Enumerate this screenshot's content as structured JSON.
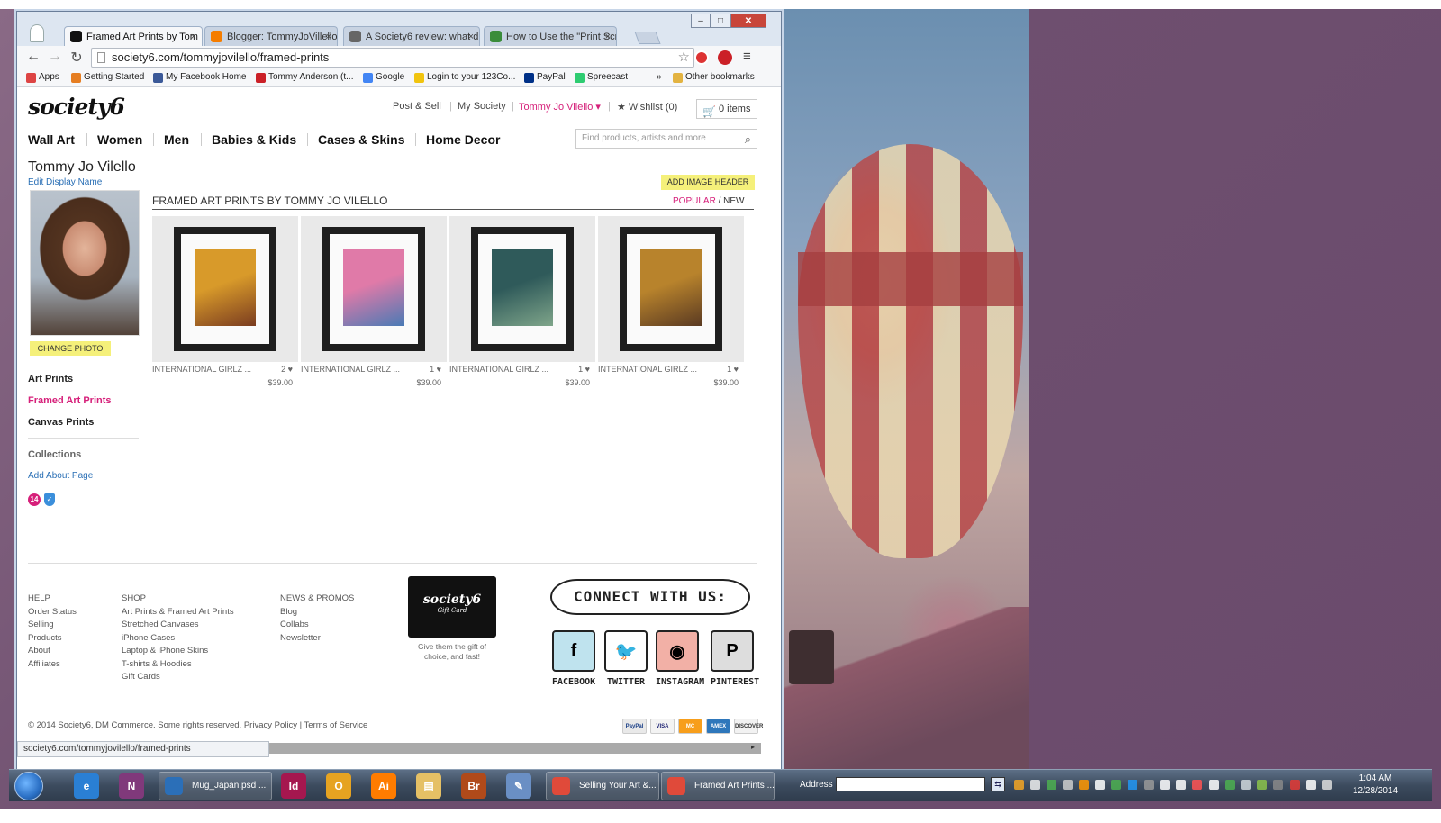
{
  "browser": {
    "tabs": [
      {
        "label": "Framed Art Prints by Tom",
        "active": true,
        "favicon_color": "#111111"
      },
      {
        "label": "Blogger: TommyJoVillello",
        "active": false,
        "favicon_color": "#f57d00"
      },
      {
        "label": "A Society6 review: what d",
        "active": false,
        "favicon_color": "#666666"
      },
      {
        "label": "How to Use the \"Print Scr",
        "active": false,
        "favicon_color": "#3a8c3a"
      }
    ],
    "url": "society6.com/tommyjovilello/framed-prints",
    "window_controls": {
      "minimize": "–",
      "maximize": "□",
      "close": "✕"
    },
    "bookmarks": [
      {
        "label": "Apps",
        "color": "#d44"
      },
      {
        "label": "Getting Started",
        "color": "#e67e22"
      },
      {
        "label": "My Facebook Home",
        "color": "#3b5998"
      },
      {
        "label": "Tommy Anderson (t...",
        "color": "#cb2027"
      },
      {
        "label": "Google",
        "color": "#4285f4"
      },
      {
        "label": "Login to your 123Co...",
        "color": "#f1c40f"
      },
      {
        "label": "PayPal",
        "color": "#003087"
      },
      {
        "label": "Spreecast",
        "color": "#2ecc71"
      },
      {
        "label": "»",
        "color": ""
      },
      {
        "label": "Other bookmarks",
        "color": "#e3b341"
      }
    ],
    "status_url": "society6.com/tommyjovilello/framed-prints"
  },
  "site": {
    "logo": "society6",
    "top_links": {
      "post_sell": "Post & Sell",
      "my_society": "My Society",
      "user": "Tommy Jo Vilello ▾",
      "wishlist": "Wishlist (0)",
      "cart": "0 items"
    },
    "main_nav": [
      "Wall Art",
      "Women",
      "Men",
      "Babies & Kids",
      "Cases & Skins",
      "Home Decor"
    ],
    "search_placeholder": "Find products, artists and more"
  },
  "profile": {
    "name": "Tommy Jo Vilello",
    "edit_display_name": "Edit Display Name",
    "change_photo": "CHANGE PHOTO",
    "links": [
      "Art Prints",
      "Framed Art Prints",
      "Canvas Prints"
    ],
    "active_link": "Framed Art Prints",
    "collections": "Collections",
    "add_about": "Add About Page",
    "badge_count": "14"
  },
  "gallery": {
    "add_image_header": "ADD IMAGE HEADER",
    "title": "FRAMED ART PRINTS BY TOMMY JO VILELLO",
    "sort_popular": "POPULAR",
    "sort_sep": " / ",
    "sort_new": "NEW",
    "products": [
      {
        "name": "INTERNATIONAL GIRLZ ...",
        "likes": "2 ♥",
        "price": "$39.00",
        "art_colors": [
          "#d89a2a",
          "#7a3c20"
        ]
      },
      {
        "name": "INTERNATIONAL GIRLZ ...",
        "likes": "1 ♥",
        "price": "$39.00",
        "art_colors": [
          "#e07aa8",
          "#4a7ab5"
        ]
      },
      {
        "name": "INTERNATIONAL GIRLZ ...",
        "likes": "1 ♥",
        "price": "$39.00",
        "art_colors": [
          "#2f5a5a",
          "#7fa58a"
        ]
      },
      {
        "name": "INTERNATIONAL GIRLZ ...",
        "likes": "1 ♥",
        "price": "$39.00",
        "art_colors": [
          "#b8832c",
          "#5a3a22"
        ]
      }
    ]
  },
  "footer": {
    "help": {
      "head": "HELP",
      "items": [
        "Order Status",
        "Selling",
        "Products",
        "About",
        "Affiliates"
      ]
    },
    "shop": {
      "head": "SHOP",
      "items": [
        "Art Prints & Framed Art Prints",
        "Stretched Canvases",
        "iPhone Cases",
        "Laptop & iPhone Skins",
        "T-shirts & Hoodies",
        "Gift Cards"
      ]
    },
    "news": {
      "head": "NEWS & PROMOS",
      "items": [
        "Blog",
        "Collabs",
        "Newsletter"
      ]
    },
    "giftcard_logo": "society6",
    "giftcard_sub": "Gift Card",
    "giftcard_text": "Give them the gift of choice, and fast!",
    "connect": "CONNECT WITH US:",
    "social": [
      {
        "label": "FACEBOOK",
        "glyph": "f",
        "bg": "#bfe3ee"
      },
      {
        "label": "TWITTER",
        "glyph": "🐦",
        "bg": "#ffffff"
      },
      {
        "label": "INSTAGRAM",
        "glyph": "◉",
        "bg": "#f2b0a6"
      },
      {
        "label": "PINTEREST",
        "glyph": "P",
        "bg": "#dddddd"
      }
    ],
    "copyright": "© 2014 Society6, DM Commerce. Some rights reserved.",
    "privacy": "Privacy Policy",
    "terms": "Terms of Service",
    "payments": [
      {
        "label": "PayPal",
        "bg": "#e9e9e9",
        "fg": "#1a3f87"
      },
      {
        "label": "VISA",
        "bg": "#f3f3f3",
        "fg": "#1a1f71"
      },
      {
        "label": "MC",
        "bg": "#f79e1b",
        "fg": "#ffffff"
      },
      {
        "label": "AMEX",
        "bg": "#2e77bb",
        "fg": "#ffffff"
      },
      {
        "label": "DISCOVER",
        "bg": "#f2f2f2",
        "fg": "#333333"
      }
    ]
  },
  "taskbar": {
    "buttons": [
      {
        "label": "Mug_Japan.psd ...",
        "color": "#2b6fb8"
      },
      {
        "label": "Selling Your Art &...",
        "color": "#e04a3a"
      },
      {
        "label": "Framed Art Prints ...",
        "color": "#e04a3a"
      }
    ],
    "pinned": [
      {
        "name": "ie-icon",
        "glyph": "e",
        "color": "#2a7fd4"
      },
      {
        "name": "onenote-icon",
        "glyph": "N",
        "color": "#80397b"
      },
      {
        "name": "indesign-icon",
        "glyph": "Id",
        "color": "#a5174f"
      },
      {
        "name": "outlook-icon",
        "glyph": "O",
        "color": "#e6a321"
      },
      {
        "name": "illustrator-icon",
        "glyph": "Ai",
        "color": "#ff7c00"
      },
      {
        "name": "explorer-icon",
        "glyph": "▤",
        "color": "#e5c065"
      },
      {
        "name": "bridge-icon",
        "glyph": "Br",
        "color": "#b04a1a"
      },
      {
        "name": "feather-icon",
        "glyph": "✎",
        "color": "#6a8fc4"
      }
    ],
    "address_label": "Address",
    "clock_time": "1:04 AM",
    "clock_date": "12/28/2014"
  }
}
